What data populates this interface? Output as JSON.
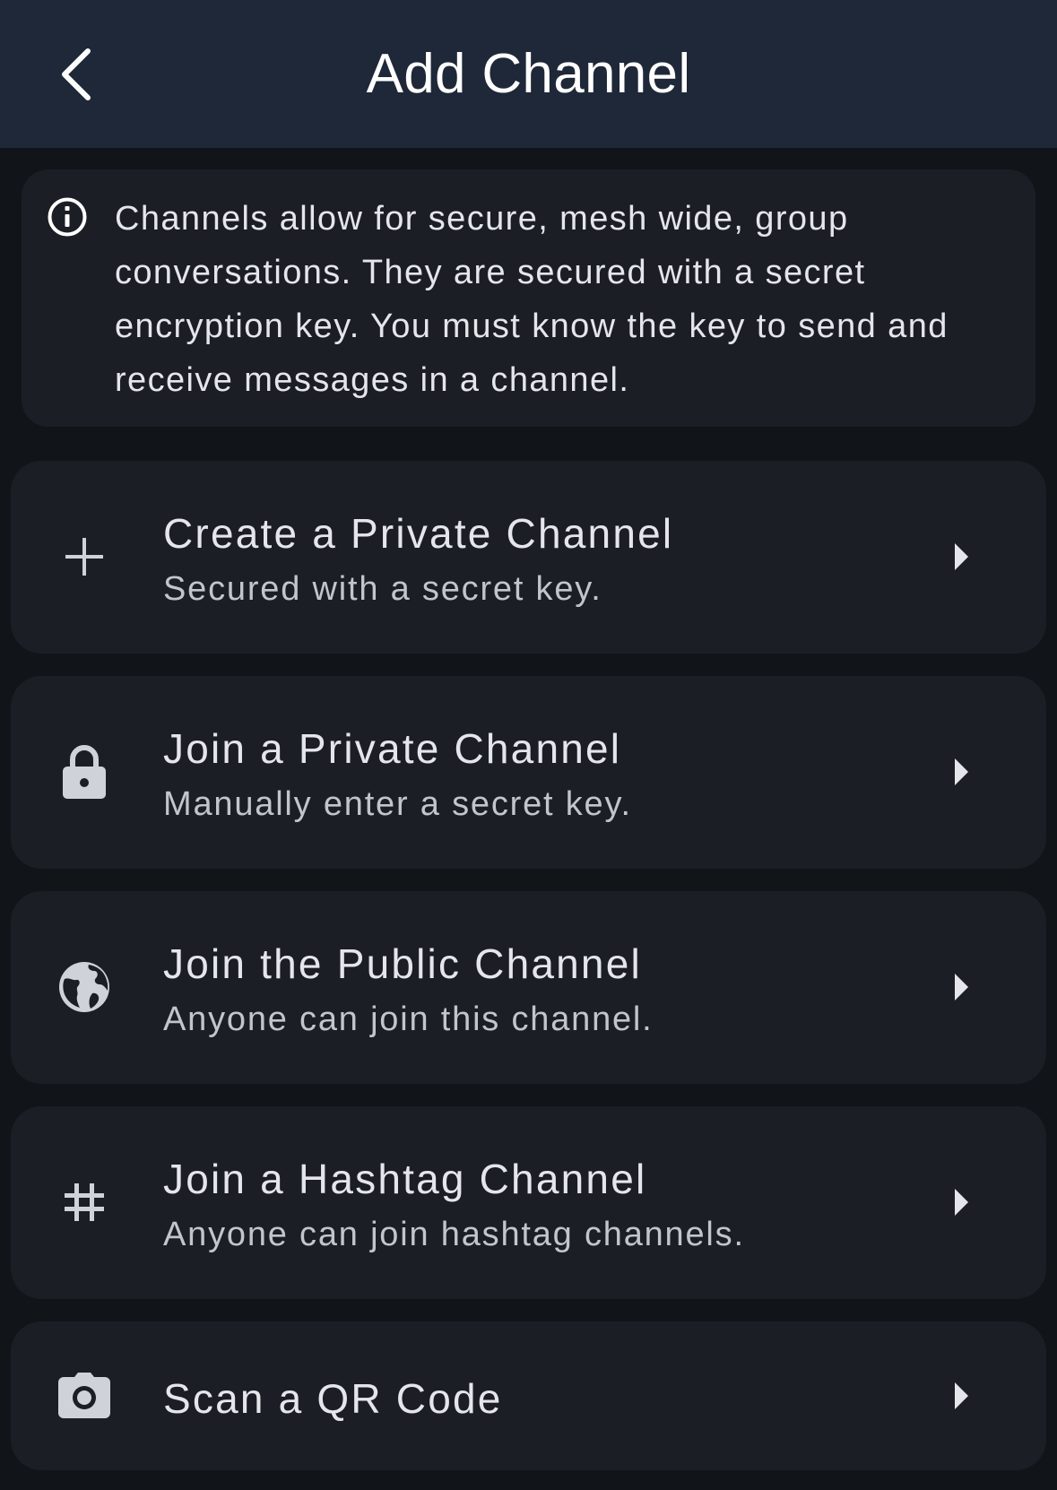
{
  "app_bar": {
    "title": "Add Channel",
    "back_icon": "chevron-left-icon"
  },
  "info": {
    "icon": "info-icon",
    "text": "Channels allow for secure, mesh wide, group conversations. They are secured with a secret encryption key. You must know the key to send and receive messages in a channel."
  },
  "options": [
    {
      "icon": "plus-icon",
      "title": "Create a Private Channel",
      "subtitle": "Secured with a secret key."
    },
    {
      "icon": "lock-icon",
      "title": "Join a Private Channel",
      "subtitle": "Manually enter a secret key."
    },
    {
      "icon": "globe-icon",
      "title": "Join the Public Channel",
      "subtitle": "Anyone can join this channel."
    },
    {
      "icon": "hashtag-icon",
      "title": "Join a Hashtag Channel",
      "subtitle": "Anyone can join hashtag channels."
    },
    {
      "icon": "camera-icon",
      "title": "Scan a QR Code"
    }
  ],
  "colors": {
    "app_bar": "#1f2838",
    "background": "#111418",
    "card": "#1b1e24",
    "text": "#e4e6eb",
    "subtext": "#c2c5cc",
    "icon": "#cfd2d8"
  }
}
